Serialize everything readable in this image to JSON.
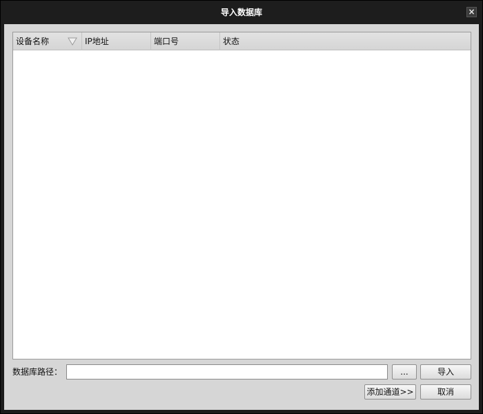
{
  "window": {
    "title": "导入数据库",
    "close_label": "×"
  },
  "table": {
    "columns": [
      {
        "label": "设备名称"
      },
      {
        "label": "IP地址"
      },
      {
        "label": "端口号"
      },
      {
        "label": "状态"
      }
    ],
    "sort_icon": "triangle-down-outline-icon",
    "rows": []
  },
  "path": {
    "label": "数据库路径：",
    "value": "",
    "placeholder": ""
  },
  "buttons": {
    "browse_label": "...",
    "import_label": "导入",
    "add_channel_label": "添加通道>>",
    "cancel_label": "取消"
  },
  "colors": {
    "titlebar": "#1d1d1d",
    "client": "#d6d6d6",
    "title_text": "#ffffff"
  }
}
